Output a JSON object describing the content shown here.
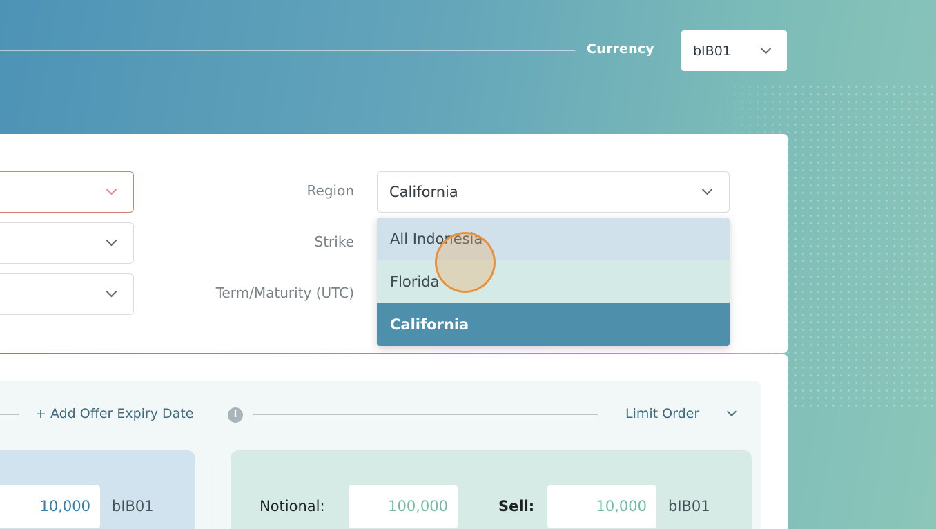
{
  "header": {
    "currency_label": "Currency",
    "currency_value": "bIB01"
  },
  "form": {
    "region_label": "Region",
    "strike_label": "Strike",
    "term_label": "Term/Maturity (UTC)",
    "region_value": "California",
    "region_options": [
      "All Indonesia",
      "Florida",
      "California"
    ],
    "region_selected_index": 2
  },
  "order": {
    "add_expiry": "+ Add Offer Expiry Date",
    "info_icon_glyph": "i",
    "order_type": "Limit Order",
    "buy_amount": "10,000",
    "buy_unit": "bIB01",
    "notional_label": "Notional:",
    "notional_value": "100,000",
    "sell_label": "Sell:",
    "sell_amount": "10,000",
    "sell_unit": "bIB01"
  },
  "colors": {
    "accent": "#4e8fab",
    "highlight_teal": "#71bca5",
    "click_indicator": "#e9913a"
  }
}
